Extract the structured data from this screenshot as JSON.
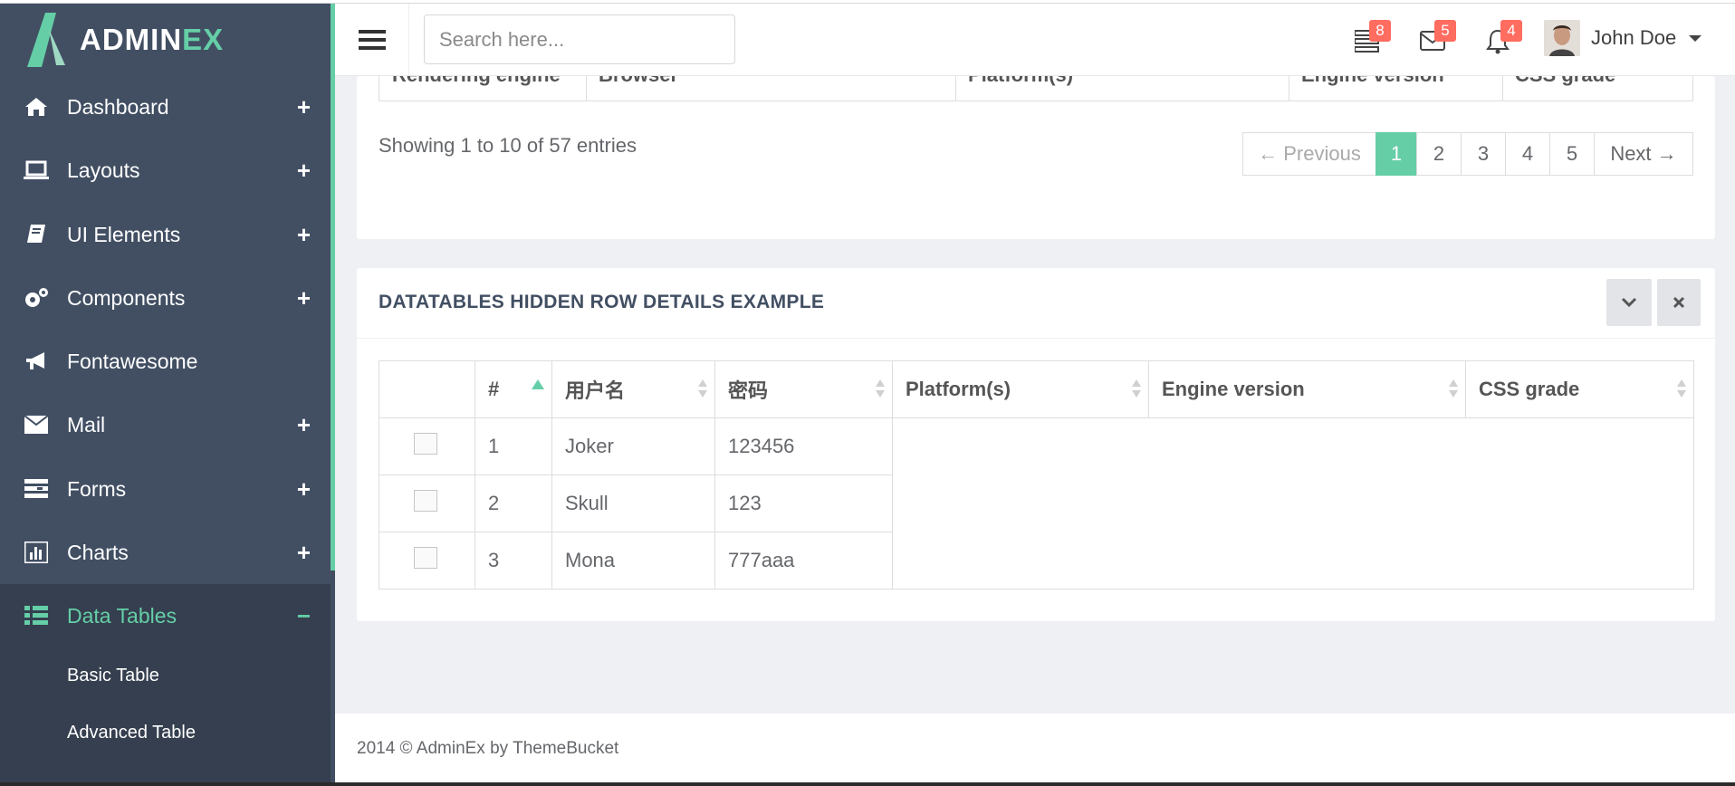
{
  "app": {
    "logo_main": "ADMIN",
    "logo_accent": "EX",
    "accent_color": "#65cea7",
    "sidebar_color": "#424f63"
  },
  "sidebar": {
    "items": [
      {
        "label": "Dashboard",
        "icon": "home-icon",
        "expander": "+"
      },
      {
        "label": "Layouts",
        "icon": "laptop-icon",
        "expander": "+"
      },
      {
        "label": "UI Elements",
        "icon": "book-icon",
        "expander": "+"
      },
      {
        "label": "Components",
        "icon": "cogs-icon",
        "expander": "+"
      },
      {
        "label": "Fontawesome",
        "icon": "bullhorn-icon",
        "expander": ""
      },
      {
        "label": "Mail",
        "icon": "envelope-icon",
        "expander": "+"
      },
      {
        "label": "Forms",
        "icon": "tasks-icon",
        "expander": "+"
      },
      {
        "label": "Charts",
        "icon": "bar-chart-icon",
        "expander": "+"
      },
      {
        "label": "Data Tables",
        "icon": "th-list-icon",
        "expander": "−"
      }
    ],
    "sub_items": [
      "Basic Table",
      "Advanced Table"
    ]
  },
  "header": {
    "search_placeholder": "Search here...",
    "badges": {
      "tasks": "8",
      "messages": "5",
      "notifications": "4"
    },
    "user_name": "John Doe"
  },
  "panel1": {
    "cut_columns": [
      "Rendering engine",
      "Browser",
      "Platform(s)",
      "Engine version",
      "CSS grade"
    ],
    "info": "Showing 1 to 10 of 57 entries",
    "pagination": {
      "previous": "← Previous",
      "pages": [
        "1",
        "2",
        "3",
        "4",
        "5"
      ],
      "next": "Next →",
      "current": "1"
    }
  },
  "panel2": {
    "title": "DATATABLES HIDDEN ROW DETAILS EXAMPLE",
    "columns": [
      "",
      "#",
      "用户名",
      "密码",
      "Platform(s)",
      "Engine version",
      "CSS grade"
    ],
    "rows": [
      {
        "num": "1",
        "user": "Joker",
        "pass": "123456"
      },
      {
        "num": "2",
        "user": "Skull",
        "pass": "123"
      },
      {
        "num": "3",
        "user": "Mona",
        "pass": "777aaa"
      }
    ]
  },
  "footer": {
    "text": "2014 © AdminEx by ThemeBucket"
  }
}
